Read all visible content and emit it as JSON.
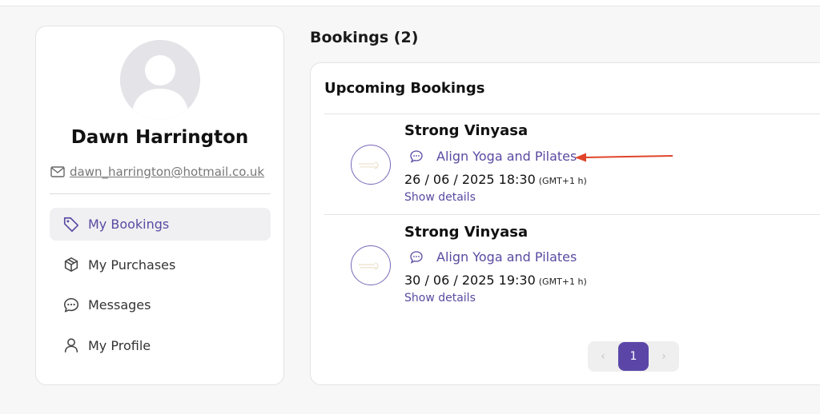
{
  "profile": {
    "name": "Dawn Harrington",
    "email": "dawn_harrington@hotmail.co.uk"
  },
  "nav": {
    "items": [
      {
        "label": "My Bookings",
        "icon": "tag-icon",
        "active": true
      },
      {
        "label": "My Purchases",
        "icon": "package-icon",
        "active": false
      },
      {
        "label": "Messages",
        "icon": "chat-bubble-icon",
        "active": false
      },
      {
        "label": "My Profile",
        "icon": "user-icon",
        "active": false
      }
    ]
  },
  "main": {
    "title": "Bookings (2)",
    "card_title": "Upcoming Bookings",
    "bookings": [
      {
        "class_name": "Strong Vinyasa",
        "studio": "Align Yoga and Pilates",
        "datetime": "26 / 06 / 2025 18:30",
        "timezone": "(GMT+1 h)",
        "details_label": "Show details"
      },
      {
        "class_name": "Strong Vinyasa",
        "studio": "Align Yoga and Pilates",
        "datetime": "30 / 06 / 2025 19:30",
        "timezone": "(GMT+1 h)",
        "details_label": "Show details"
      }
    ],
    "pagination": {
      "prev": "‹",
      "current": "1",
      "next": "›"
    }
  },
  "colors": {
    "accent": "#5b46a8",
    "link": "#5a4aa1",
    "annotation_arrow": "#e0452b"
  }
}
